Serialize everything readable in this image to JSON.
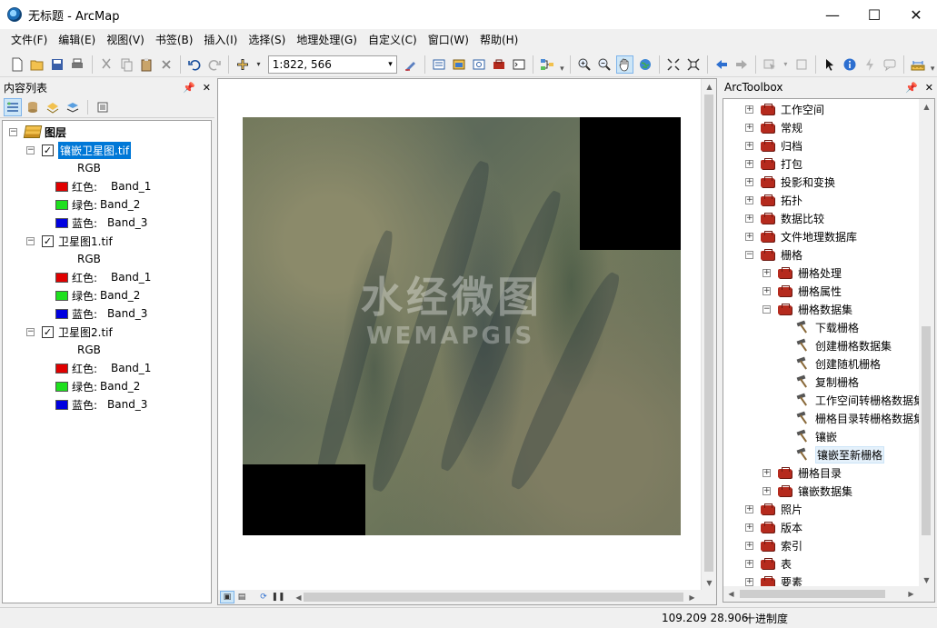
{
  "window": {
    "title": "无标题 - ArcMap",
    "minimize": "—",
    "maximize": "☐",
    "close": "✕"
  },
  "menubar": [
    "文件(F)",
    "编辑(E)",
    "视图(V)",
    "书签(B)",
    "插入(I)",
    "选择(S)",
    "地理处理(G)",
    "自定义(C)",
    "窗口(W)",
    "帮助(H)"
  ],
  "toolbar": {
    "scale": "1:822, 566",
    "active_tool": "pan"
  },
  "toc": {
    "title": "内容列表",
    "root": "图层",
    "layers": [
      {
        "name": "镶嵌卫星图.tif",
        "selected": true,
        "checked": true,
        "render": "RGB",
        "bands": [
          {
            "label": "红色:",
            "band": "Band_1",
            "color": "#e00000"
          },
          {
            "label": "绿色:",
            "band": "Band_2",
            "color": "#1ee01e"
          },
          {
            "label": "蓝色:",
            "band": "Band_3",
            "color": "#0000e0"
          }
        ]
      },
      {
        "name": "卫星图1.tif",
        "selected": false,
        "checked": true,
        "render": "RGB",
        "bands": [
          {
            "label": "红色:",
            "band": "Band_1",
            "color": "#e00000"
          },
          {
            "label": "绿色:",
            "band": "Band_2",
            "color": "#1ee01e"
          },
          {
            "label": "蓝色:",
            "band": "Band_3",
            "color": "#0000e0"
          }
        ]
      },
      {
        "name": "卫星图2.tif",
        "selected": false,
        "checked": true,
        "render": "RGB",
        "bands": [
          {
            "label": "红色:",
            "band": "Band_1",
            "color": "#e00000"
          },
          {
            "label": "绿色:",
            "band": "Band_2",
            "color": "#1ee01e"
          },
          {
            "label": "蓝色:",
            "band": "Band_3",
            "color": "#0000e0"
          }
        ]
      }
    ]
  },
  "map": {
    "watermark_cn": "水经微图",
    "watermark_en": "WEMAPGIS"
  },
  "arctoolbox": {
    "title": "ArcToolbox",
    "items": [
      {
        "label": "工作空间",
        "level": 0,
        "kind": "box",
        "expanded": false
      },
      {
        "label": "常规",
        "level": 0,
        "kind": "box",
        "expanded": false
      },
      {
        "label": "归档",
        "level": 0,
        "kind": "box",
        "expanded": false
      },
      {
        "label": "打包",
        "level": 0,
        "kind": "box",
        "expanded": false
      },
      {
        "label": "投影和变换",
        "level": 0,
        "kind": "box",
        "expanded": false
      },
      {
        "label": "拓扑",
        "level": 0,
        "kind": "box",
        "expanded": false
      },
      {
        "label": "数据比较",
        "level": 0,
        "kind": "box",
        "expanded": false
      },
      {
        "label": "文件地理数据库",
        "level": 0,
        "kind": "box",
        "expanded": false
      },
      {
        "label": "栅格",
        "level": 0,
        "kind": "box",
        "expanded": true
      },
      {
        "label": "栅格处理",
        "level": 1,
        "kind": "box",
        "expanded": false
      },
      {
        "label": "栅格属性",
        "level": 1,
        "kind": "box",
        "expanded": false
      },
      {
        "label": "栅格数据集",
        "level": 1,
        "kind": "box",
        "expanded": true
      },
      {
        "label": "下载栅格",
        "level": 2,
        "kind": "tool"
      },
      {
        "label": "创建栅格数据集",
        "level": 2,
        "kind": "tool"
      },
      {
        "label": "创建随机栅格",
        "level": 2,
        "kind": "tool"
      },
      {
        "label": "复制栅格",
        "level": 2,
        "kind": "tool"
      },
      {
        "label": "工作空间转栅格数据集",
        "level": 2,
        "kind": "tool"
      },
      {
        "label": "栅格目录转栅格数据集",
        "level": 2,
        "kind": "tool"
      },
      {
        "label": "镶嵌",
        "level": 2,
        "kind": "tool"
      },
      {
        "label": "镶嵌至新栅格",
        "level": 2,
        "kind": "tool",
        "highlighted": true
      },
      {
        "label": "栅格目录",
        "level": 1,
        "kind": "box",
        "expanded": false
      },
      {
        "label": "镶嵌数据集",
        "level": 1,
        "kind": "box",
        "expanded": false
      },
      {
        "label": "照片",
        "level": 0,
        "kind": "box",
        "expanded": false
      },
      {
        "label": "版本",
        "level": 0,
        "kind": "box",
        "expanded": false
      },
      {
        "label": "索引",
        "level": 0,
        "kind": "box",
        "expanded": false
      },
      {
        "label": "表",
        "level": 0,
        "kind": "box",
        "expanded": false
      },
      {
        "label": "要素",
        "level": 0,
        "kind": "box",
        "expanded": false
      }
    ]
  },
  "status": {
    "coordinates": "109.209  28.906",
    "units": "十进制度"
  }
}
